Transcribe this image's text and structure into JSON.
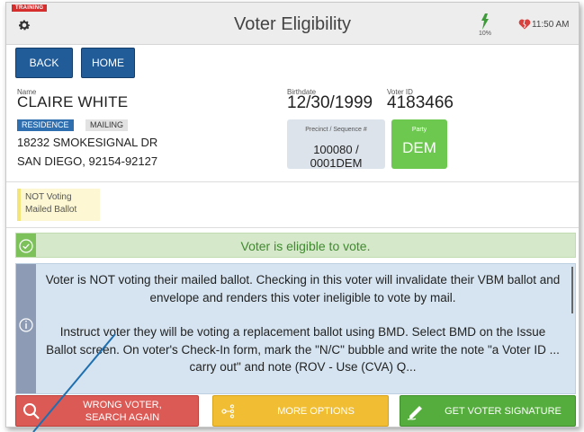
{
  "header": {
    "training_badge": "TRAINING",
    "title": "Voter Eligibility",
    "battery": "10%",
    "time": "11:50 AM"
  },
  "nav": {
    "back": "BACK",
    "home": "HOME"
  },
  "voter": {
    "name_label": "Name",
    "name": "CLAIRE WHITE",
    "tabs": [
      "RESIDENCE",
      "MAILING"
    ],
    "address_line1": "18232 SMOKESIGNAL DR",
    "address_line2": "SAN DIEGO, 92154-92127",
    "birthdate_label": "Birthdate",
    "birthdate": "12/30/1999",
    "voterid_label": "Voter ID",
    "voterid": "4183466",
    "precinct_label": "Precinct / Sequence #",
    "precinct": "100080 / 0001DEM",
    "party_label": "Party",
    "party": "DEM"
  },
  "status": {
    "line1": "NOT Voting",
    "line2": "Mailed Ballot"
  },
  "eligibility": "Voter is eligible to vote.",
  "info": {
    "para1": "Voter is NOT voting their mailed ballot. Checking in this voter will invalidate their VBM ballot and envelope and renders this voter ineligible to vote by mail.",
    "para2": "Instruct voter they will be voting a replacement ballot using BMD. Select BMD on the Issue Ballot screen. On voter's Check-In form, mark the \"N/C\" bubble and write the note \"a Voter ID ... carry out\" and note (ROV - Use (CVA) Q..."
  },
  "buttons": {
    "wrong_voter_line1": "WRONG VOTER,",
    "wrong_voter_line2": "SEARCH AGAIN",
    "more_options": "MORE OPTIONS",
    "get_signature": "GET VOTER SIGNATURE"
  },
  "colors": {
    "header_bg": "#ededed",
    "nav_blue": "#215c99",
    "party_green": "#6cc84f",
    "eligible_bg": "#d5e8c9",
    "info_bg": "#d5e4f0",
    "wrong_red": "#dc5a55",
    "more_yellow": "#f0bd33",
    "sig_green": "#54ad3c"
  }
}
